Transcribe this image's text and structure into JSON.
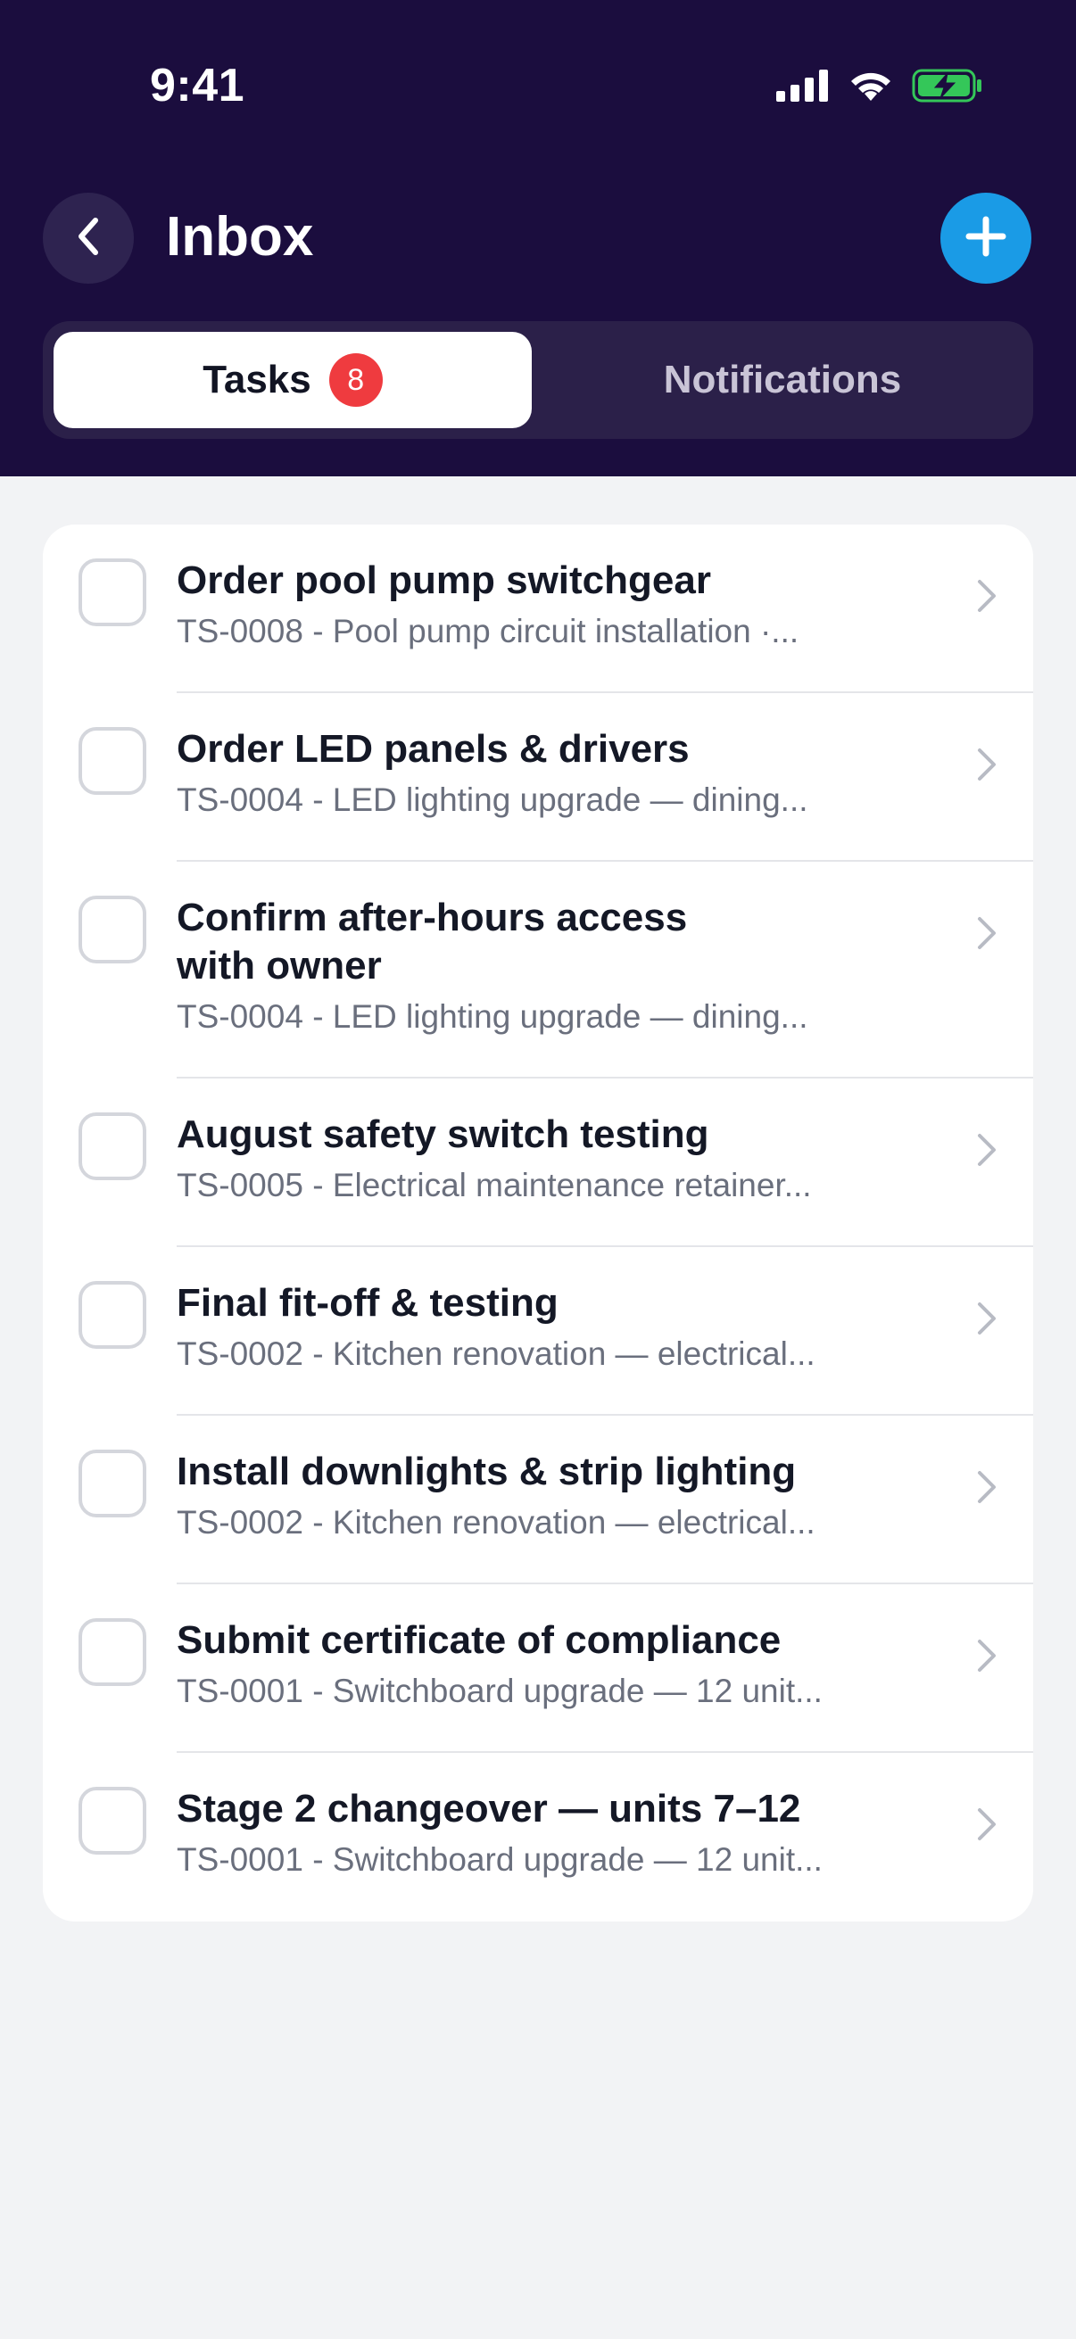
{
  "status_bar": {
    "time": "9:41",
    "icons": [
      "cellular-signal-icon",
      "wifi-icon",
      "battery-charging-icon"
    ]
  },
  "nav": {
    "title": "Inbox",
    "back_icon": "chevron-left-icon",
    "add_icon": "plus-icon"
  },
  "tabs": {
    "tasks_label": "Tasks",
    "tasks_count": "8",
    "notifications_label": "Notifications",
    "active": "Tasks"
  },
  "tasks": [
    {
      "title": "Order pool pump switchgear",
      "subtitle": "TS-0008 - Pool pump circuit installation ·..."
    },
    {
      "title": "Order LED panels & drivers",
      "subtitle": "TS-0004 - LED lighting upgrade — dining..."
    },
    {
      "title": "Confirm after-hours access with owner",
      "subtitle": "TS-0004 - LED lighting upgrade — dining..."
    },
    {
      "title": "August safety switch testing",
      "subtitle": "TS-0005 - Electrical maintenance retainer..."
    },
    {
      "title": "Final fit-off & testing",
      "subtitle": "TS-0002 - Kitchen renovation — electrical..."
    },
    {
      "title": "Install downlights & strip lighting",
      "subtitle": "TS-0002 - Kitchen renovation — electrical..."
    },
    {
      "title": "Submit certificate of compliance",
      "subtitle": "TS-0001 - Switchboard upgrade — 12 unit..."
    },
    {
      "title": "Stage 2 changeover — units 7–12",
      "subtitle": "TS-0001 - Switchboard upgrade — 12 unit..."
    }
  ],
  "colors": {
    "header_bg": "#1b0d3e",
    "accent": "#1a9be6",
    "badge": "#ef3b3f",
    "page_bg": "#f2f3f5"
  }
}
